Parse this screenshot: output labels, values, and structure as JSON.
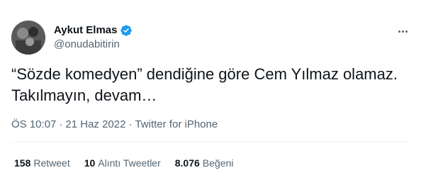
{
  "user": {
    "display_name": "Aykut Elmas",
    "handle": "@onudabitirin",
    "verified": true
  },
  "tweet": {
    "lines": [
      "“Sözde komedyen” dendiğine göre Cem Yılmaz olamaz.",
      "Takılmayın, devam…"
    ]
  },
  "meta": {
    "time": "ÖS 10:07",
    "date": "21 Haz 2022",
    "source": "Twitter for iPhone",
    "separator": "·"
  },
  "stats": [
    {
      "count": "158",
      "label": "Retweet"
    },
    {
      "count": "10",
      "label": "Alıntı Tweetler"
    },
    {
      "count": "8.076",
      "label": "Beğeni"
    }
  ],
  "colors": {
    "verified_badge": "#1d9bf0",
    "secondary_text": "#536471",
    "primary_text": "#0f1419"
  }
}
